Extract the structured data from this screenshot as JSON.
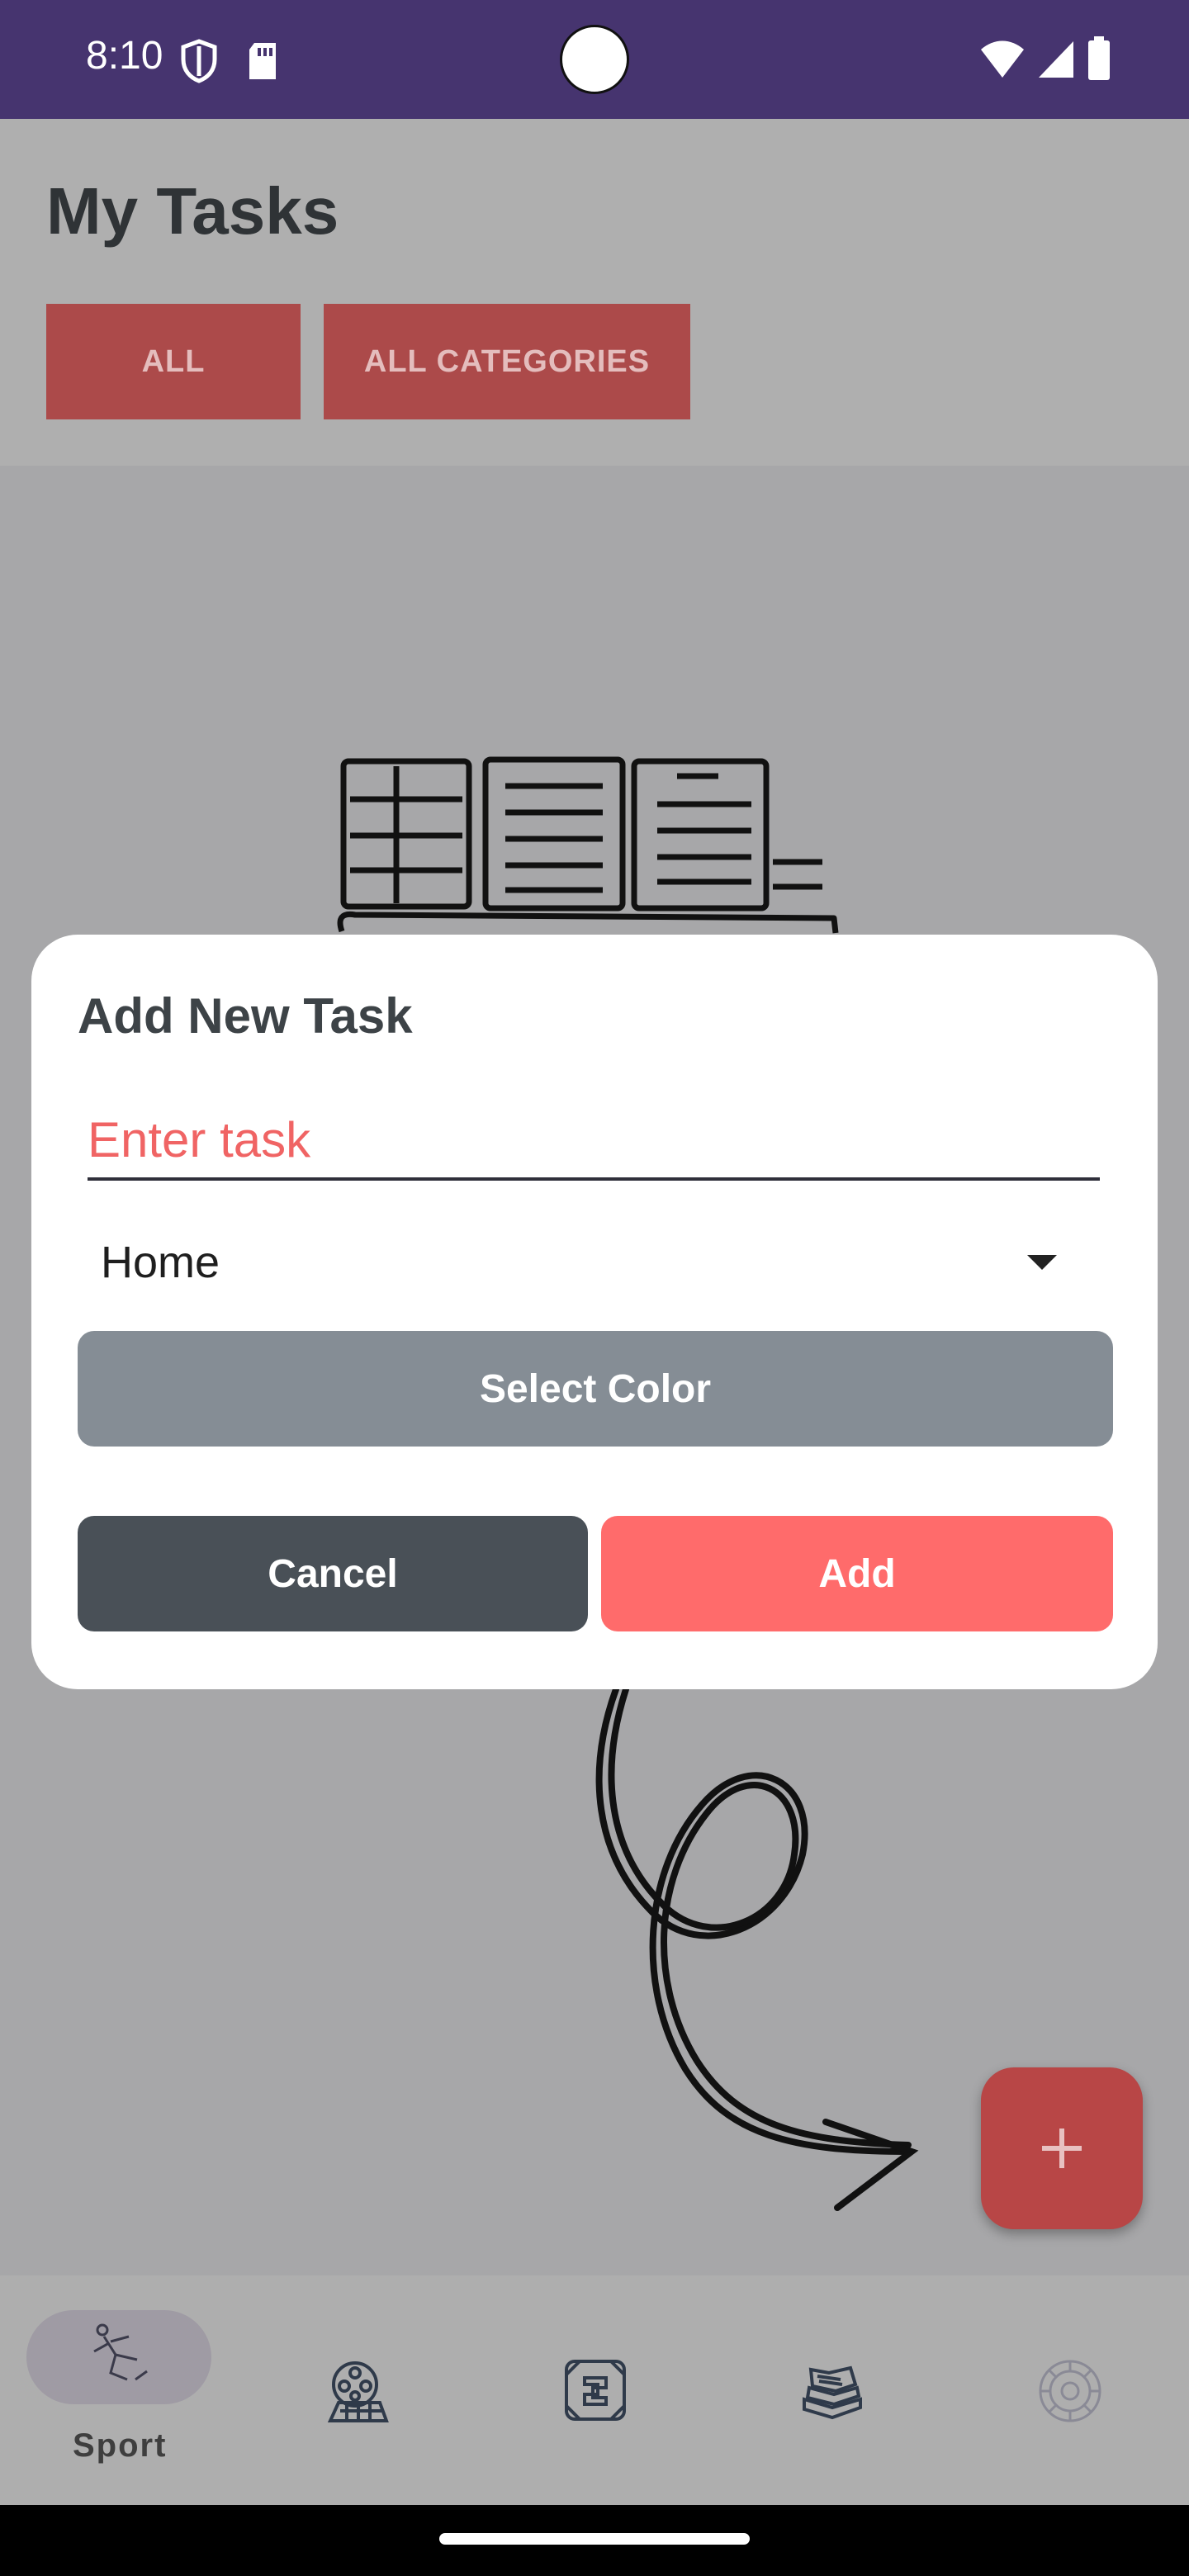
{
  "status_bar": {
    "time": "8:10",
    "icons": [
      "shield-icon",
      "sd-card-icon",
      "wifi-icon",
      "cell-signal-icon",
      "battery-icon"
    ]
  },
  "header": {
    "title": "My Tasks",
    "filters": [
      {
        "label": "ALL"
      },
      {
        "label": "ALL CATEGORIES"
      }
    ]
  },
  "dialog": {
    "title": "Add New Task",
    "task_input": {
      "placeholder": "Enter task",
      "value": ""
    },
    "category": {
      "selected": "Home"
    },
    "select_color_label": "Select Color",
    "cancel_label": "Cancel",
    "add_label": "Add"
  },
  "fab": {
    "icon": "plus-icon"
  },
  "bottom_nav": {
    "items": [
      {
        "label": "Sport",
        "icon": "sport-runner-icon",
        "selected": true
      },
      {
        "icon": "movie-reel-icon"
      },
      {
        "icon": "puzzle-badge-icon"
      },
      {
        "icon": "books-stack-icon"
      },
      {
        "icon": "gear-wheel-icon"
      }
    ]
  },
  "colors": {
    "status_bar": "#46346F",
    "filter_button": "#AC4A4A",
    "add_button": "#FF6B6B",
    "cancel_button": "#495057",
    "select_color_button": "#858D95",
    "fab": "#B84646",
    "placeholder": "#F06464"
  }
}
